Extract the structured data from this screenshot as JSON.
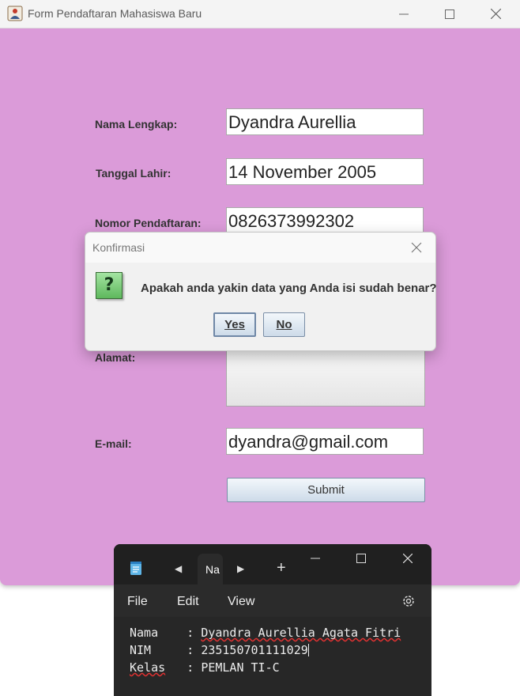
{
  "window": {
    "title": "Form Pendaftaran Mahasiswa Baru",
    "background": "#db9bd9"
  },
  "form": {
    "fields": [
      {
        "label": "Nama Lengkap:",
        "value": "Dyandra Aurellia"
      },
      {
        "label": "Tanggal Lahir:",
        "value": "14 November 2005"
      },
      {
        "label": "Nomor Pendaftaran:",
        "value": "0826373992302"
      },
      {
        "label": "Alamat:",
        "value": ""
      },
      {
        "label": "E-mail:",
        "value": "dyandra@gmail.com"
      }
    ],
    "submit_label": "Submit"
  },
  "dialog": {
    "title": "Konfirmasi",
    "icon": "question-icon",
    "icon_glyph": "?",
    "message": "Apakah anda yakin data yang Anda isi sudah benar?",
    "yes_label": "Yes",
    "no_label": "No"
  },
  "notepad": {
    "tab_label": "Na",
    "menu": [
      "File",
      "Edit",
      "View"
    ],
    "lines": [
      {
        "key": "Nama",
        "sep": "    : ",
        "value": "Dyandra Aurellia Agata Fitri"
      },
      {
        "key": "NIM",
        "sep": "     : ",
        "value": "235150701111029"
      },
      {
        "key": "Kelas",
        "sep": "   : ",
        "value": "PEMLAN TI-C"
      }
    ]
  }
}
